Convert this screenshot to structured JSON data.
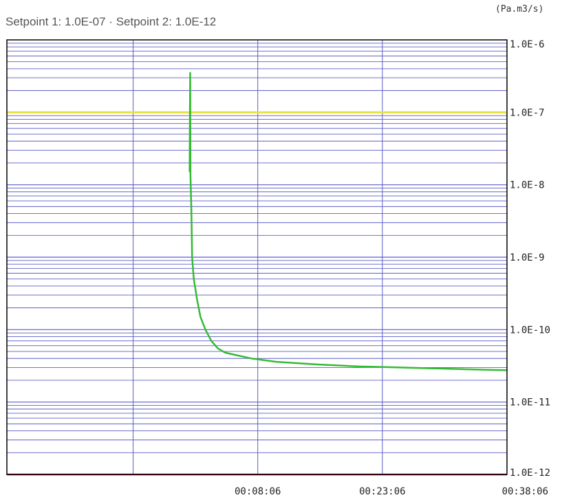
{
  "header": {
    "setpoint1_label": "Setpoint 1:",
    "setpoint1_value": "1.0E-07",
    "separator": "·",
    "setpoint2_label": "Setpoint 2:",
    "setpoint2_value": "1.0E-12",
    "unit": "(Pa.m3/s)"
  },
  "colors": {
    "grid": "#5b5bc8",
    "axis": "#000000",
    "series": "#33bb33",
    "setpoint1": "#e8e040",
    "setpoint2": "#cc1144"
  },
  "chart_data": {
    "type": "line",
    "title": "",
    "xlabel": "",
    "ylabel": "",
    "y_scale": "log",
    "ylim": [
      1e-12,
      1e-06
    ],
    "y_tick_labels": [
      "1.0E-6",
      "1.0E-7",
      "1.0E-8",
      "1.0E-9",
      "1.0E-10",
      "1.0E-11",
      "1.0E-12"
    ],
    "y_tick_values": [
      1e-06,
      1e-07,
      1e-08,
      1e-09,
      1e-10,
      1e-11,
      1e-12
    ],
    "x_tick_labels": [
      "00:08:06",
      "00:23:06",
      "00:38:06"
    ],
    "x_tick_values": [
      "00:08:06",
      "00:23:06",
      "00:38:06"
    ],
    "xlim": [
      "-00:22:06",
      "00:38:06"
    ],
    "grid": true,
    "reference_lines": [
      {
        "name": "Setpoint 1",
        "value": 1e-07
      },
      {
        "name": "Setpoint 2",
        "value": 1e-12
      }
    ],
    "series": [
      {
        "x": [
          "-00:00:06",
          "-00:00:04",
          "-00:00:02",
          "00:00:00",
          "00:00:06",
          "00:00:12",
          "00:00:24",
          "00:00:48",
          "00:01:12",
          "00:01:48",
          "00:02:30",
          "00:03:18",
          "00:04:12",
          "00:05:18",
          "00:07:18",
          "00:10:18",
          "00:15:18",
          "00:20:18",
          "00:25:18",
          "00:30:18",
          "00:35:18",
          "00:38:06"
        ],
        "y": [
          1.5e-08,
          1e-07,
          3.5e-07,
          1.3e-08,
          5e-09,
          1e-09,
          5e-10,
          2.6e-10,
          1.5e-10,
          1e-10,
          7e-11,
          5.5e-11,
          4.8e-11,
          4.5e-11,
          4e-11,
          3.6e-11,
          3.3e-11,
          3.1e-11,
          3e-11,
          2.9e-11,
          2.8e-11,
          2.75e-11
        ]
      }
    ]
  }
}
